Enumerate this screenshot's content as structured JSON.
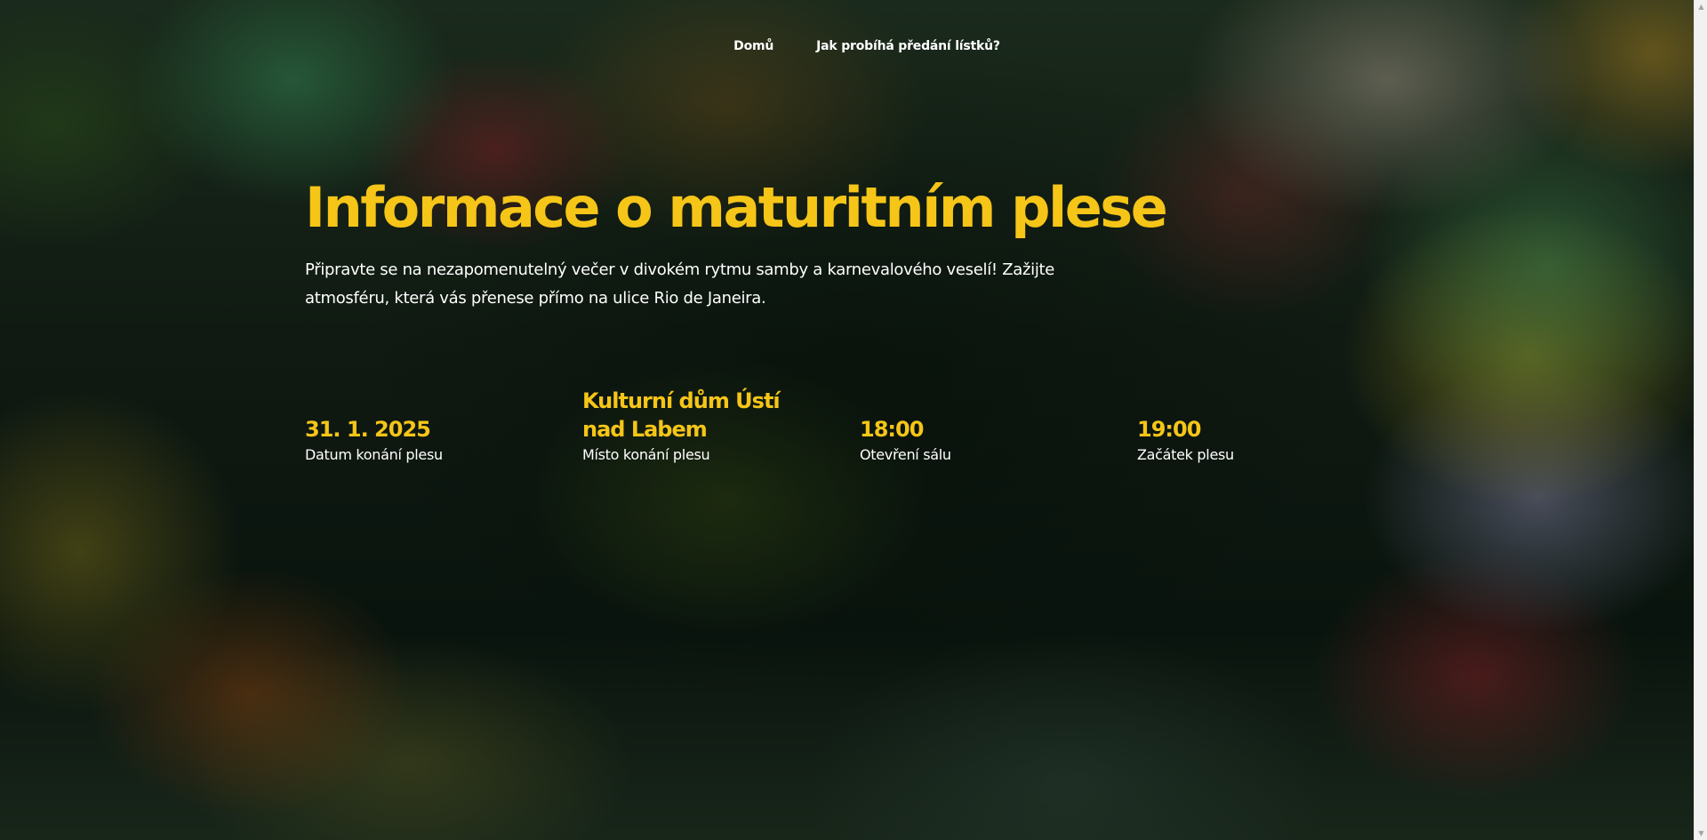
{
  "nav": {
    "items": [
      {
        "label": "Domů"
      },
      {
        "label": "Jak probíhá předání lístků?"
      }
    ]
  },
  "hero": {
    "title": "Informace o maturitním plese",
    "description": "Připravte se na nezapomenutelný večer v divokém rytmu samby a karnevalového veselí! Zažijte atmosféru, která vás přenese přímo na ulice Rio de Janeira."
  },
  "facts": [
    {
      "value": "31. 1. 2025",
      "label": "Datum konání plesu"
    },
    {
      "value": "Kulturní dům Ústí nad Labem",
      "label": "Místo konání plesu"
    },
    {
      "value": "18:00",
      "label": "Otevření sálu"
    },
    {
      "value": "19:00",
      "label": "Začátek plesu"
    }
  ],
  "colors": {
    "accent": "#f5c518",
    "text": "#ffffff"
  },
  "scrollbar": {
    "up_icon": "▲",
    "down_icon": "▼"
  }
}
